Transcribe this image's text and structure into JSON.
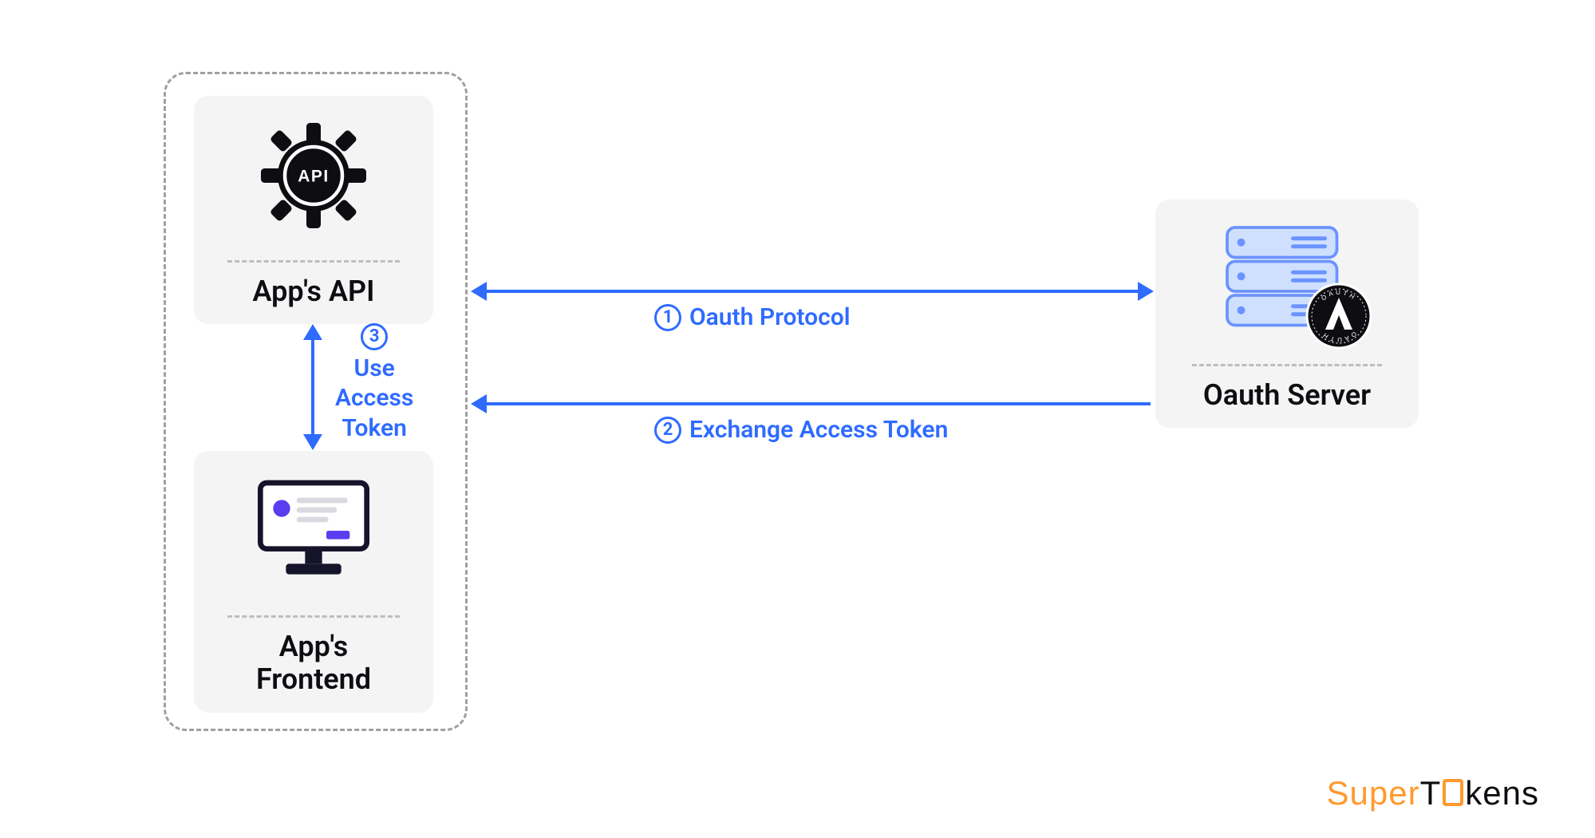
{
  "group": {
    "api_label": "App's API",
    "frontend_label": "App's\nFrontend"
  },
  "server": {
    "label": "Oauth Server"
  },
  "arrows": {
    "one": {
      "num": "1",
      "text": "Oauth Protocol"
    },
    "two": {
      "num": "2",
      "text": "Exchange Access Token"
    },
    "three": {
      "num": "3",
      "text": "Use\nAccess\nToken"
    }
  },
  "logo": {
    "part1": "Super",
    "part2_pre": "T",
    "part2_post": "kens"
  },
  "colors": {
    "accent_blue": "#2f6bff",
    "light_blue": "#cfe0ff",
    "stroke_blue": "#6b93ff",
    "card_bg": "#f4f4f5",
    "dash_gray": "#a0a0a0",
    "black": "#0d0d12",
    "orange": "#ff9a2e"
  }
}
